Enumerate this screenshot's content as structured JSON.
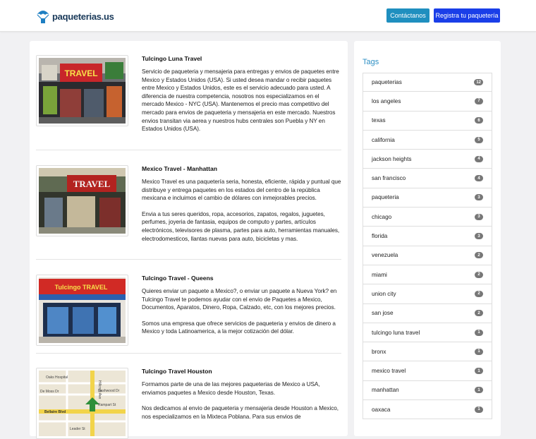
{
  "header": {
    "brand": "paqueterias.us",
    "contact_label": "Contáctanos",
    "register_label": "Registra tu paquetería"
  },
  "listings": [
    {
      "title": "Tulcingo Luna Travel",
      "paragraphs": [
        "Servicio de paqueteria y mensajeria para entregas y envios de paquetes entre Mexico y Estados Unidos (USA). Si usted desea mandar o recibir paquetes entre Mexico y Estados Unidos, este es el servicio adecuado para usted. A diferencia de nuestra competencia, nosotros nos especializamos en el mercado Mexico - NYC (USA). Mantenemos el precio mas competitivo del mercado para envios de paqueteria y mensajeria en este mercado. Nuestros envios transitan via aerea y nuestros hubs centrales son Puebla y NY en Estados Unidos (USA)."
      ]
    },
    {
      "title": "Mexico Travel - Manhattan",
      "paragraphs": [
        "Mexico Travel es una paquetería seria, honesta, eficiente, rápida y puntual que distribuye y entrega paquetes en los estados del centro de la república mexicana e incluimos el cambio de dólares con inmejorables precios.",
        "Envia a tus seres queridos, ropa, accesorios, zapatos, regalos, juguetes, perfumes, joyeria de fantasia, equipos de computo y partes, artículos electrónicos, televisores de plasma, partes para auto, herramientas manuales, electrodomesticos, llantas nuevas para auto, bicicletas y mas."
      ]
    },
    {
      "title": "Tulcingo Travel - Queens",
      "paragraphs": [
        "Quieres enviar un paquete a Mexico?, o enviar un paquete a Nueva York? en Tulcingo Travel te podemos ayudar con el envio de Paquetes a Mexico, Documentos, Aparatos, Dinero, Ropa, Calzado, etc, con los mejores precios.",
        "Somos una empresa que ofrece servicios de paqueteria y envios de dinero a Mexico y toda Latinoamerica, a la mejor cotización del dólar."
      ]
    },
    {
      "title": "Tulcingo Travel Houston",
      "paragraphs": [
        "Formamos parte de una de las mejores paqueterias de Mexico a USA, enviamos paquetes a Mexico desde Houston, Texas.",
        "Nos dedicamos al envio de paqueteria y mensajeria desde Houston a Mexico, nos especializamos en la Mixteca Poblana. Para sus envios de"
      ]
    }
  ],
  "thumbs": {
    "luna": {
      "sign1": "TRAVEL"
    },
    "manhattan": {
      "sign1": "TRAVEL",
      "sign2": "TRAVEL"
    },
    "queens": {
      "sign1": "Tulcingo TRAVEL"
    },
    "houston": {
      "labels": [
        "Oaks Hospital",
        "De Moss Dr",
        "Dashwood Dr",
        "Rampart St",
        "Bellaire Blvd",
        "Leader St",
        "Hillcroft Ave"
      ]
    }
  },
  "sidebar": {
    "title": "Tags",
    "tags": [
      {
        "label": "paqueterias",
        "count": "12"
      },
      {
        "label": "los angeles",
        "count": "7"
      },
      {
        "label": "texas",
        "count": "6"
      },
      {
        "label": "california",
        "count": "5"
      },
      {
        "label": "jackson heights",
        "count": "4"
      },
      {
        "label": "san francisco",
        "count": "4"
      },
      {
        "label": "paqueteria",
        "count": "3"
      },
      {
        "label": "chicago",
        "count": "3"
      },
      {
        "label": "florida",
        "count": "3"
      },
      {
        "label": "venezuela",
        "count": "2"
      },
      {
        "label": "miami",
        "count": "2"
      },
      {
        "label": "union city",
        "count": "2"
      },
      {
        "label": "san jose",
        "count": "2"
      },
      {
        "label": "tulcingo luna travel",
        "count": "1"
      },
      {
        "label": "bronx",
        "count": "1"
      },
      {
        "label": "mexico travel",
        "count": "1"
      },
      {
        "label": "manhattan",
        "count": "1"
      },
      {
        "label": "oaxaca",
        "count": "1"
      }
    ]
  },
  "colors": {
    "contact_button": "#1f8fbf",
    "register_button": "#1a3ee8",
    "tags_title": "#2d8fc4",
    "badge": "#777777"
  }
}
